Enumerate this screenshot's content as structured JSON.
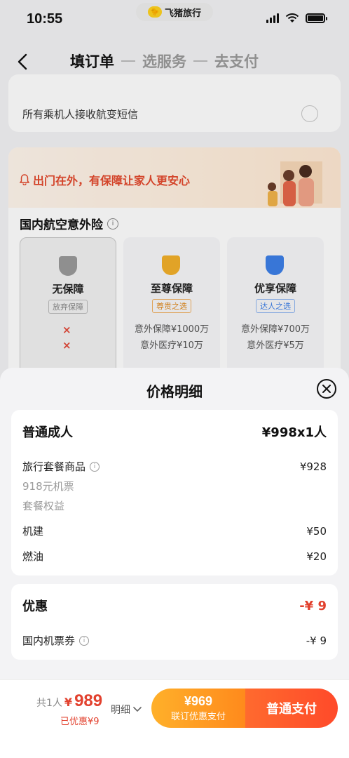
{
  "status": {
    "time": "10:55",
    "app_pill": "飞猪旅行"
  },
  "nav": {
    "step1": "填订单",
    "step2": "选服务",
    "step3": "去支付"
  },
  "background": {
    "sms_label": "所有乘机人接收航变短信",
    "banner_slogan": "出门在外，有保障让家人更安心",
    "insurance_title": "国内航空意外险",
    "options": [
      {
        "name": "无保障",
        "tag": "放弃保障"
      },
      {
        "name": "至尊保障",
        "tag": "尊贵之选",
        "feat1": "意外保障¥1000万",
        "feat2": "意外医疗¥10万"
      },
      {
        "name": "优享保障",
        "tag": "达人之选",
        "feat1": "意外保障¥700万",
        "feat2": "意外医疗¥5万"
      }
    ],
    "x_mark": "×"
  },
  "sheet": {
    "title": "价格明细",
    "adult": {
      "label": "普通成人",
      "value": "¥998x1人",
      "package_label": "旅行套餐商品",
      "package_value": "¥928",
      "ticket_sub": "918元机票",
      "benefit_sub": "套餐权益",
      "airport_label": "机建",
      "airport_value": "¥50",
      "fuel_label": "燃油",
      "fuel_value": "¥20"
    },
    "discount": {
      "label": "优惠",
      "value": "-¥ 9",
      "coupon_label": "国内机票券",
      "coupon_value": "-¥ 9"
    }
  },
  "footer": {
    "count": "共1人",
    "currency": "¥",
    "amount": "989",
    "saved": "已优惠¥9",
    "detail": "明细",
    "combo_price": "¥969",
    "combo_label": "联订优惠支付",
    "normal_pay": "普通支付"
  },
  "colors": {
    "accent_red": "#e2412e",
    "orange": "#ff8a1c"
  },
  "icons": [
    "back-icon",
    "wifi-icon",
    "battery-icon",
    "close-icon",
    "info-icon",
    "bell-icon",
    "chevron-down-icon"
  ]
}
